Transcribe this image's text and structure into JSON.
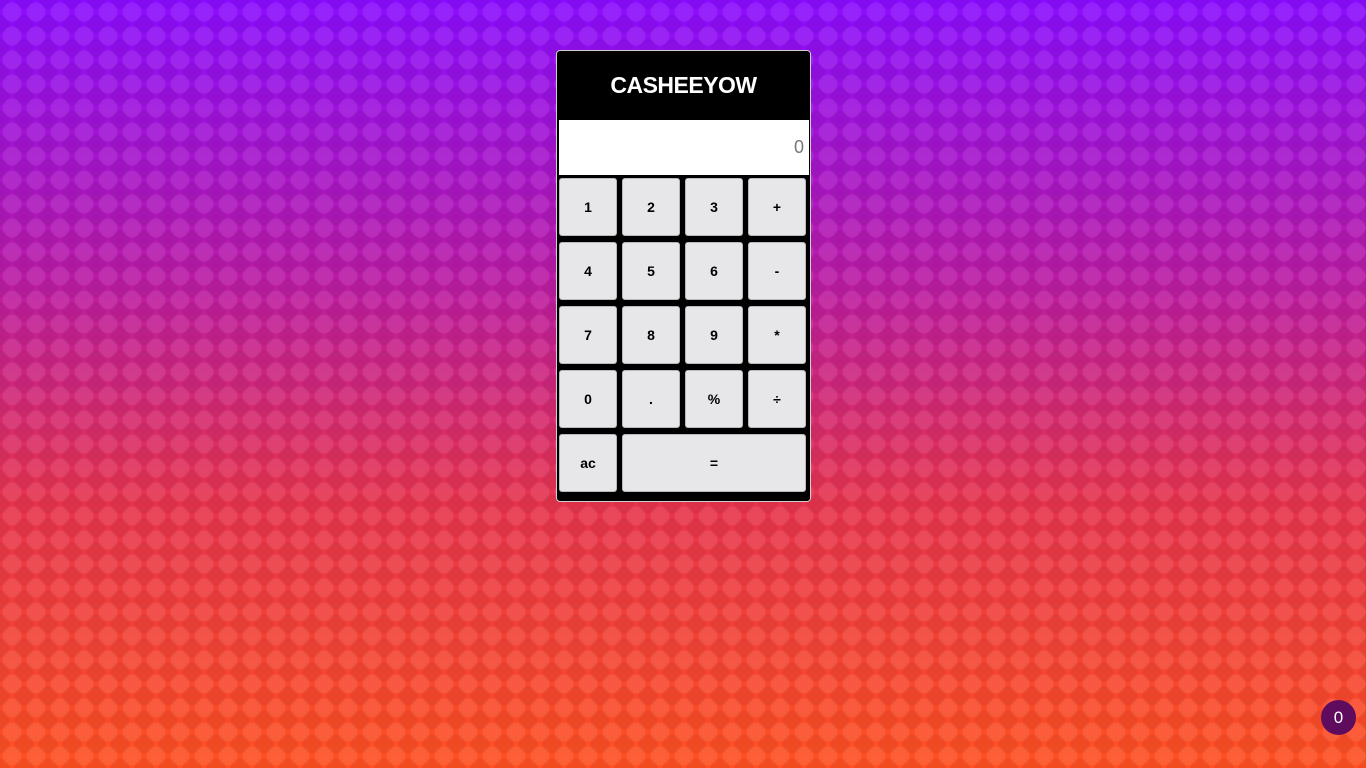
{
  "calculator": {
    "title": "CASHEEYOW",
    "display_value": "0",
    "keys": {
      "k1": "1",
      "k2": "2",
      "k3": "3",
      "plus": "+",
      "k4": "4",
      "k5": "5",
      "k6": "6",
      "minus": "-",
      "k7": "7",
      "k8": "8",
      "k9": "9",
      "multiply": "*",
      "k0": "0",
      "decimal": ".",
      "percent": "%",
      "divide": "÷",
      "clear": "ac",
      "equals": "="
    }
  },
  "badge": {
    "count": "0"
  },
  "colors": {
    "background_top": "#8a0cff",
    "background_bottom": "#ff5020",
    "calculator_body": "#000000",
    "key_face": "#e7e7ea",
    "badge": "#5f0c5f"
  }
}
